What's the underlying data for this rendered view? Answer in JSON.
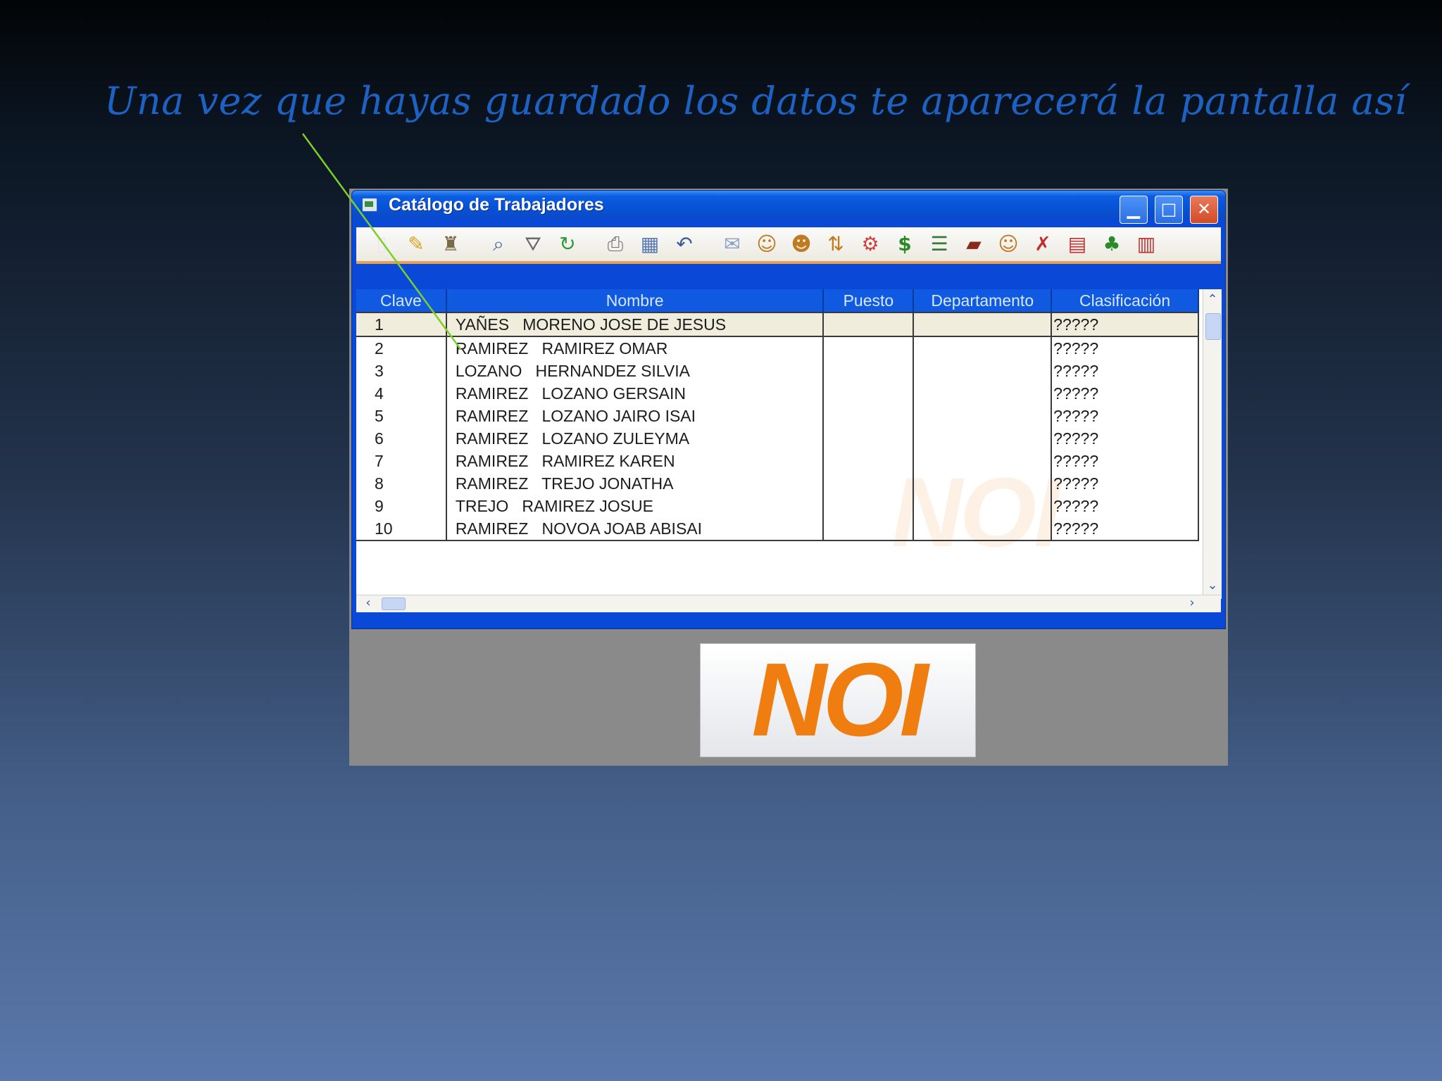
{
  "slide": {
    "title": "Una vez que hayas guardado los datos te aparecerá la pantalla así"
  },
  "window": {
    "title": "Catálogo de Trabajadores",
    "controls": {
      "minimize": "▁",
      "maximize": "□",
      "close": "✕"
    }
  },
  "toolbar": {
    "icons": [
      "new-icon",
      "edit-icon",
      "delete-icon",
      "search-icon",
      "filter-icon",
      "refresh-icon",
      "print-icon",
      "columns-icon",
      "undo-icon",
      "mail-icon",
      "add-worker-icon",
      "add-worker-2-icon",
      "move-worker-icon",
      "rates-icon",
      "salary-icon",
      "list-icon",
      "book-icon",
      "replace-worker-icon",
      "edit-delete-icon",
      "calendar-delete-icon",
      "vacation-icon",
      "table-delete-icon"
    ]
  },
  "grid": {
    "columns": [
      "Clave",
      "Nombre",
      "Puesto",
      "Departamento",
      "Clasificación"
    ],
    "rows": [
      {
        "clave": "1",
        "nombre": "YAÑES   MORENO JOSE DE JESUS",
        "puesto": "",
        "departamento": "",
        "clasificacion": "?????"
      },
      {
        "clave": "2",
        "nombre": "RAMIREZ   RAMIREZ OMAR",
        "puesto": "",
        "departamento": "",
        "clasificacion": "?????"
      },
      {
        "clave": "3",
        "nombre": "LOZANO   HERNANDEZ SILVIA",
        "puesto": "",
        "departamento": "",
        "clasificacion": "?????"
      },
      {
        "clave": "4",
        "nombre": "RAMIREZ   LOZANO GERSAIN",
        "puesto": "",
        "departamento": "",
        "clasificacion": "?????"
      },
      {
        "clave": "5",
        "nombre": "RAMIREZ   LOZANO JAIRO ISAI",
        "puesto": "",
        "departamento": "",
        "clasificacion": "?????"
      },
      {
        "clave": "6",
        "nombre": "RAMIREZ   LOZANO ZULEYMA",
        "puesto": "",
        "departamento": "",
        "clasificacion": "?????"
      },
      {
        "clave": "7",
        "nombre": "RAMIREZ   RAMIREZ KAREN",
        "puesto": "",
        "departamento": "",
        "clasificacion": "?????"
      },
      {
        "clave": "8",
        "nombre": "RAMIREZ   TREJO JONATHA",
        "puesto": "",
        "departamento": "",
        "clasificacion": "?????"
      },
      {
        "clave": "9",
        "nombre": "TREJO   RAMIREZ JOSUE",
        "puesto": "",
        "departamento": "",
        "clasificacion": "?????"
      },
      {
        "clave": "10",
        "nombre": "RAMIREZ   NOVOA JOAB ABISAI",
        "puesto": "",
        "departamento": "",
        "clasificacion": "?????"
      }
    ],
    "selected_row": 0,
    "watermark": "NOI"
  },
  "logo": {
    "text": "NOI",
    "color": "#f07d10"
  },
  "colors": {
    "title": "#1d62c2",
    "header": "#0f5ae0",
    "window_frame": "#0a49d8",
    "pointer": "#7ccf2a"
  }
}
